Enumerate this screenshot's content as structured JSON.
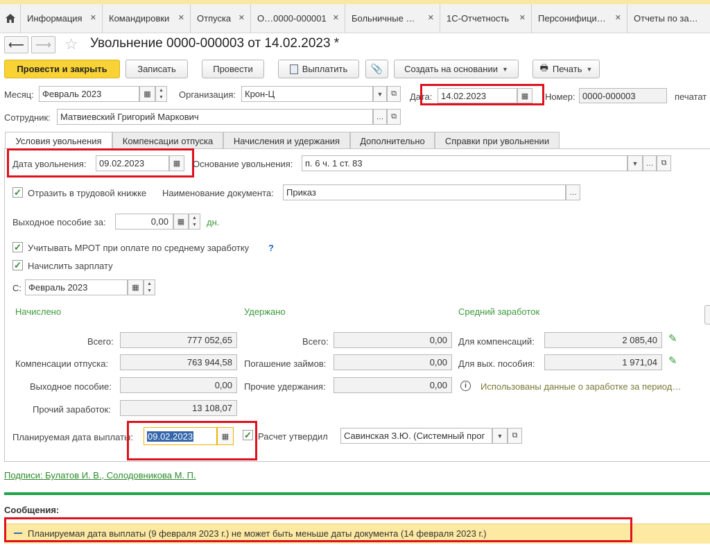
{
  "top_tabs": [
    "Информация",
    "Командировки",
    "Отпуска",
    "О…0000-000001",
    "Больничные …",
    "1С-Отчетность",
    "Персонифици…",
    "Отчеты по за…"
  ],
  "document_title": "Увольнение 0000-000003 от 14.02.2023 *",
  "toolbar": {
    "post_close": "Провести и закрыть",
    "save": "Записать",
    "post": "Провести",
    "pay": "Выплатить",
    "create_based": "Создать на основании",
    "print": "Печать"
  },
  "header": {
    "month_label": "Месяц:",
    "month_value": "Февраль 2023",
    "org_label": "Организация:",
    "org_value": "Крон-Ц",
    "date_label": "Дата:",
    "date_value": "14.02.2023",
    "number_label": "Номер:",
    "number_value": "0000-000003",
    "print_label": "печатат",
    "employee_label": "Сотрудник:",
    "employee_value": "Матвиевский Григорий Маркович"
  },
  "form_tabs": [
    "Условия увольнения",
    "Компенсации отпуска",
    "Начисления и удержания",
    "Дополнительно",
    "Справки при увольнении"
  ],
  "conditions": {
    "dismissal_date_label": "Дата увольнения:",
    "dismissal_date_value": "09.02.2023",
    "basis_label": "Основание увольнения:",
    "basis_value": "п. 6 ч. 1 ст. 83",
    "labor_book_label": "Отразить в трудовой книжке",
    "doc_name_label": "Наименование документа:",
    "doc_name_value": "Приказ",
    "severance_label": "Выходное пособие за:",
    "severance_value": "0,00",
    "severance_unit": "дн.",
    "mrot_label": "Учитывать МРОТ при оплате по среднему заработку",
    "mrot_help": "?",
    "accrue_label": "Начислить зарплату",
    "from_label": "С:",
    "from_value": "Февраль 2023"
  },
  "accrued": {
    "heading": "Начислено",
    "total_label": "Всего:",
    "total_value": "777 052,65",
    "vac_label": "Компенсации отпуска:",
    "vac_value": "763 944,58",
    "sev_label": "Выходное пособие:",
    "sev_value": "0,00",
    "other_label": "Прочий заработок:",
    "other_value": "13 108,07"
  },
  "withheld": {
    "heading": "Удержано",
    "total_label": "Всего:",
    "total_value": "0,00",
    "loans_label": "Погашение займов:",
    "loans_value": "0,00",
    "other_label": "Прочие удержания:",
    "other_value": "0,00"
  },
  "average": {
    "heading": "Средний заработок",
    "comp_label": "Для компенсаций:",
    "comp_value": "2 085,40",
    "sev_label": "Для вых. пособия:",
    "sev_value": "1 971,04",
    "info_text": "Использованы данные о заработке за период…"
  },
  "payment": {
    "planned_label": "Планируемая дата выплаты:",
    "planned_value": "09.02.2023",
    "approved_label": "Расчет утвердил",
    "approved_value": "Савинская З.Ю. (Системный прог"
  },
  "signatures_link": "Подписи: Булатов И. В., Солодовникова М. П.",
  "messages": {
    "heading": "Сообщения:",
    "items": [
      "Планируемая дата выплаты (9 февраля 2023 г.) не может быть меньше даты документа (14 февраля 2023 г.)"
    ]
  },
  "colors": {
    "accent_yellow": "#f9d236",
    "green_text": "#3a9a3a",
    "highlight_red": "#e0101c",
    "message_bg": "#fde9a2"
  }
}
